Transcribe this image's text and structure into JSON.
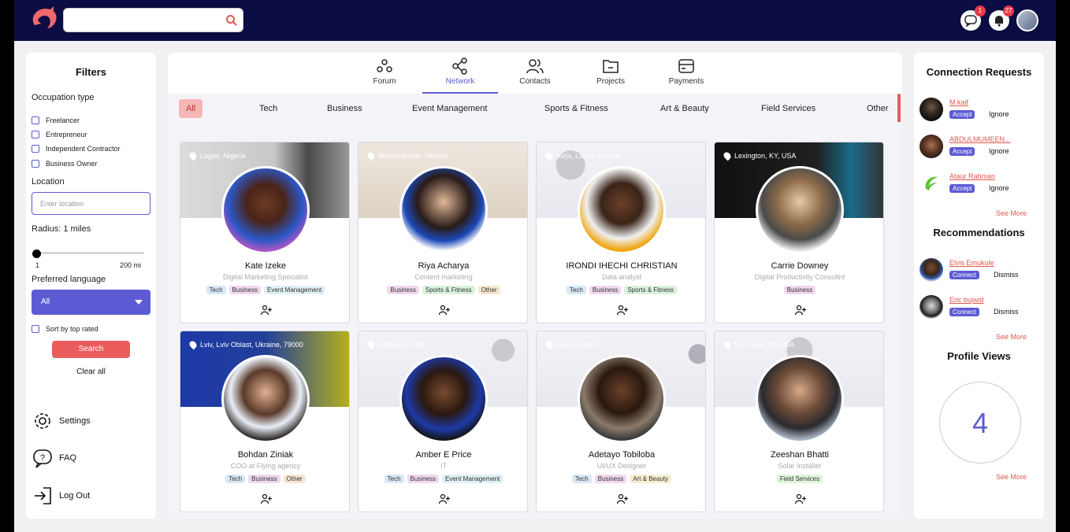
{
  "topbar": {
    "search_placeholder": "",
    "messages_badge": "1",
    "notifications_badge": "27"
  },
  "filters": {
    "title": "Filters",
    "occupation_label": "Occupation type",
    "occupations": [
      "Freelancer",
      "Entrepreneur",
      "Independent Contractor",
      "Business Owner"
    ],
    "location_label": "Location",
    "location_placeholder": "Enter location",
    "radius_label": "Radius: 1 miles",
    "radius_min": "1",
    "radius_max": "200 mi",
    "radius_value": 1,
    "language_label": "Preferred language",
    "language_value": "All",
    "sort_label": "Sort by top rated",
    "search_label": "Search",
    "clear_label": "Clear all",
    "nav": [
      "Settings",
      "FAQ",
      "Log Out"
    ]
  },
  "tabs": [
    "Forum",
    "Network",
    "Contacts",
    "Projects",
    "Payments"
  ],
  "active_tab": "Network",
  "categories": [
    "All",
    "Tech",
    "Business",
    "Event Management",
    "Sports & Fitness",
    "Art & Beauty",
    "Field Services",
    "Other"
  ],
  "active_category": "All",
  "people": [
    {
      "name": "Kate Izeke",
      "role": "Digital Marketing Specialist",
      "location": "Lagos, Nigeria",
      "tags": [
        "Tech",
        "Business",
        "Event Management"
      ]
    },
    {
      "name": "Riya Acharya",
      "role": "Content marketing",
      "location": "Bhubaneswar, Odisha",
      "tags": [
        "Business",
        "Sports & Fitness",
        "Other"
      ]
    },
    {
      "name": "IRONDI IHECHI CHRISTIAN",
      "role": "Data analyst",
      "location": "Ikeja, Lagos, Nigeria",
      "tags": [
        "Tech",
        "Business",
        "Sports & Fitness"
      ]
    },
    {
      "name": "Carrie Downey",
      "role": "Digital Productivity Consultnt",
      "location": "Lexington, KY, USA",
      "tags": [
        "Business"
      ]
    },
    {
      "name": "Bohdan Ziniak",
      "role": "COO at Flying agency",
      "location": "Lviv, Lviv Oblast, Ukraine, 79000",
      "tags": [
        "Tech",
        "Business",
        "Other"
      ]
    },
    {
      "name": "Amber E Price",
      "role": "IT",
      "location": "Alabama, USA",
      "tags": [
        "Tech",
        "Business",
        "Event Management"
      ]
    },
    {
      "name": "Adetayo Tobiloba",
      "role": "UI/UX Designer",
      "location": "Osun, Nigeria",
      "tags": [
        "Tech",
        "Business",
        "Art & Beauty"
      ]
    },
    {
      "name": "Zeeshan Bhatti",
      "role": "Solar Installer",
      "location": "Louisville, KY, USA",
      "tags": [
        "Field Services"
      ]
    }
  ],
  "connection_requests": {
    "title": "Connection Requests",
    "items": [
      {
        "name": "M kaif",
        "accept": "Accept",
        "ignore": "Ignore"
      },
      {
        "name": "ABDULMUMEEN...",
        "accept": "Accept",
        "ignore": "Ignore"
      },
      {
        "name": "Ataur Rahman",
        "accept": "Accept",
        "ignore": "Ignore"
      }
    ],
    "see_more": "See More"
  },
  "recommendations": {
    "title": "Recommendations",
    "items": [
      {
        "name": "Elvis Emukule",
        "connect": "Connect",
        "dismiss": "Dismiss"
      },
      {
        "name": "Eric bujwid",
        "connect": "Connect",
        "dismiss": "Dismiss"
      }
    ],
    "see_more": "See More"
  },
  "profile_views": {
    "title": "Profile Views",
    "count": "4",
    "see_more": "See More"
  },
  "colors": {
    "topbar": "#0c0c44",
    "accent": "#5d5bd4",
    "danger": "#eb5d5d"
  }
}
